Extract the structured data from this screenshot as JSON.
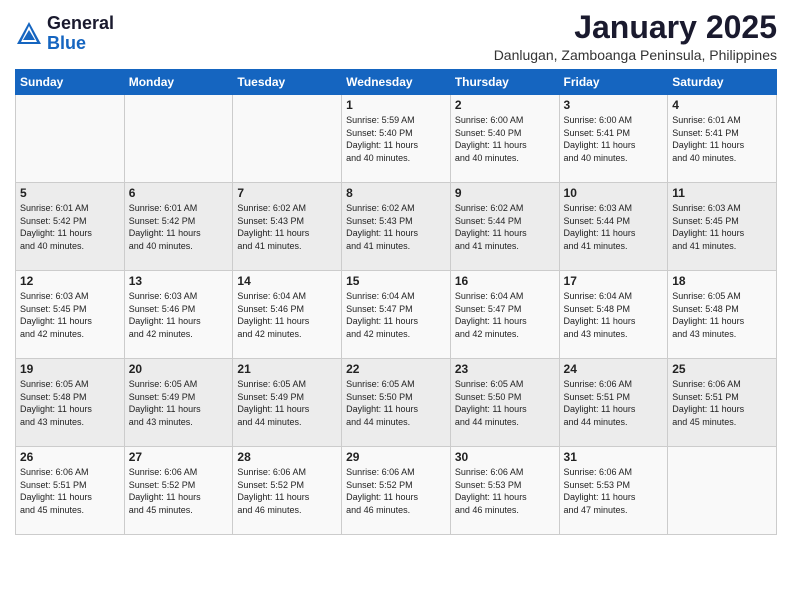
{
  "logo": {
    "general": "General",
    "blue": "Blue"
  },
  "title": "January 2025",
  "location": "Danlugan, Zamboanga Peninsula, Philippines",
  "headers": [
    "Sunday",
    "Monday",
    "Tuesday",
    "Wednesday",
    "Thursday",
    "Friday",
    "Saturday"
  ],
  "weeks": [
    [
      {
        "day": "",
        "info": ""
      },
      {
        "day": "",
        "info": ""
      },
      {
        "day": "",
        "info": ""
      },
      {
        "day": "1",
        "info": "Sunrise: 5:59 AM\nSunset: 5:40 PM\nDaylight: 11 hours\nand 40 minutes."
      },
      {
        "day": "2",
        "info": "Sunrise: 6:00 AM\nSunset: 5:40 PM\nDaylight: 11 hours\nand 40 minutes."
      },
      {
        "day": "3",
        "info": "Sunrise: 6:00 AM\nSunset: 5:41 PM\nDaylight: 11 hours\nand 40 minutes."
      },
      {
        "day": "4",
        "info": "Sunrise: 6:01 AM\nSunset: 5:41 PM\nDaylight: 11 hours\nand 40 minutes."
      }
    ],
    [
      {
        "day": "5",
        "info": "Sunrise: 6:01 AM\nSunset: 5:42 PM\nDaylight: 11 hours\nand 40 minutes."
      },
      {
        "day": "6",
        "info": "Sunrise: 6:01 AM\nSunset: 5:42 PM\nDaylight: 11 hours\nand 40 minutes."
      },
      {
        "day": "7",
        "info": "Sunrise: 6:02 AM\nSunset: 5:43 PM\nDaylight: 11 hours\nand 41 minutes."
      },
      {
        "day": "8",
        "info": "Sunrise: 6:02 AM\nSunset: 5:43 PM\nDaylight: 11 hours\nand 41 minutes."
      },
      {
        "day": "9",
        "info": "Sunrise: 6:02 AM\nSunset: 5:44 PM\nDaylight: 11 hours\nand 41 minutes."
      },
      {
        "day": "10",
        "info": "Sunrise: 6:03 AM\nSunset: 5:44 PM\nDaylight: 11 hours\nand 41 minutes."
      },
      {
        "day": "11",
        "info": "Sunrise: 6:03 AM\nSunset: 5:45 PM\nDaylight: 11 hours\nand 41 minutes."
      }
    ],
    [
      {
        "day": "12",
        "info": "Sunrise: 6:03 AM\nSunset: 5:45 PM\nDaylight: 11 hours\nand 42 minutes."
      },
      {
        "day": "13",
        "info": "Sunrise: 6:03 AM\nSunset: 5:46 PM\nDaylight: 11 hours\nand 42 minutes."
      },
      {
        "day": "14",
        "info": "Sunrise: 6:04 AM\nSunset: 5:46 PM\nDaylight: 11 hours\nand 42 minutes."
      },
      {
        "day": "15",
        "info": "Sunrise: 6:04 AM\nSunset: 5:47 PM\nDaylight: 11 hours\nand 42 minutes."
      },
      {
        "day": "16",
        "info": "Sunrise: 6:04 AM\nSunset: 5:47 PM\nDaylight: 11 hours\nand 42 minutes."
      },
      {
        "day": "17",
        "info": "Sunrise: 6:04 AM\nSunset: 5:48 PM\nDaylight: 11 hours\nand 43 minutes."
      },
      {
        "day": "18",
        "info": "Sunrise: 6:05 AM\nSunset: 5:48 PM\nDaylight: 11 hours\nand 43 minutes."
      }
    ],
    [
      {
        "day": "19",
        "info": "Sunrise: 6:05 AM\nSunset: 5:48 PM\nDaylight: 11 hours\nand 43 minutes."
      },
      {
        "day": "20",
        "info": "Sunrise: 6:05 AM\nSunset: 5:49 PM\nDaylight: 11 hours\nand 43 minutes."
      },
      {
        "day": "21",
        "info": "Sunrise: 6:05 AM\nSunset: 5:49 PM\nDaylight: 11 hours\nand 44 minutes."
      },
      {
        "day": "22",
        "info": "Sunrise: 6:05 AM\nSunset: 5:50 PM\nDaylight: 11 hours\nand 44 minutes."
      },
      {
        "day": "23",
        "info": "Sunrise: 6:05 AM\nSunset: 5:50 PM\nDaylight: 11 hours\nand 44 minutes."
      },
      {
        "day": "24",
        "info": "Sunrise: 6:06 AM\nSunset: 5:51 PM\nDaylight: 11 hours\nand 44 minutes."
      },
      {
        "day": "25",
        "info": "Sunrise: 6:06 AM\nSunset: 5:51 PM\nDaylight: 11 hours\nand 45 minutes."
      }
    ],
    [
      {
        "day": "26",
        "info": "Sunrise: 6:06 AM\nSunset: 5:51 PM\nDaylight: 11 hours\nand 45 minutes."
      },
      {
        "day": "27",
        "info": "Sunrise: 6:06 AM\nSunset: 5:52 PM\nDaylight: 11 hours\nand 45 minutes."
      },
      {
        "day": "28",
        "info": "Sunrise: 6:06 AM\nSunset: 5:52 PM\nDaylight: 11 hours\nand 46 minutes."
      },
      {
        "day": "29",
        "info": "Sunrise: 6:06 AM\nSunset: 5:52 PM\nDaylight: 11 hours\nand 46 minutes."
      },
      {
        "day": "30",
        "info": "Sunrise: 6:06 AM\nSunset: 5:53 PM\nDaylight: 11 hours\nand 46 minutes."
      },
      {
        "day": "31",
        "info": "Sunrise: 6:06 AM\nSunset: 5:53 PM\nDaylight: 11 hours\nand 47 minutes."
      },
      {
        "day": "",
        "info": ""
      }
    ]
  ]
}
